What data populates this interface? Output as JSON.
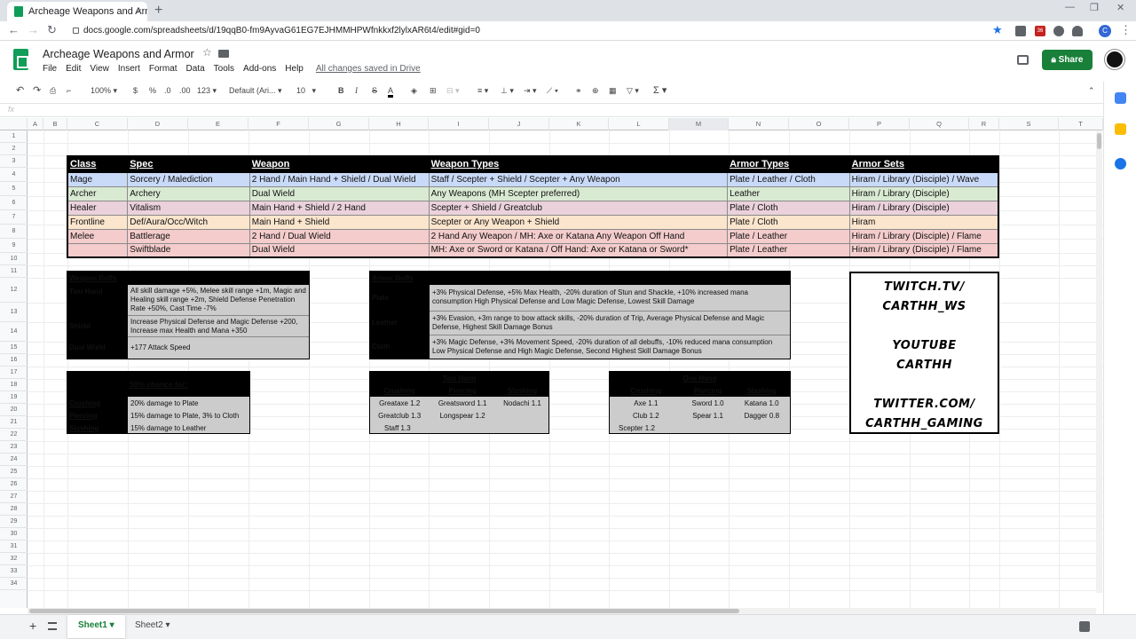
{
  "browser": {
    "tab_title": "Archeage Weapons and Armor -",
    "tab_close": "×",
    "new_tab": "+",
    "url": "docs.google.com/spreadsheets/d/19qqB0-fm9AyvaG61EG7EJHMMHPWfnkkxf2lylxAR6t4/edit#gid=0",
    "ext_badge": "36"
  },
  "doc": {
    "title": "Archeage Weapons and Armor",
    "menus": [
      "File",
      "Edit",
      "View",
      "Insert",
      "Format",
      "Data",
      "Tools",
      "Add-ons",
      "Help"
    ],
    "saved_status": "All changes saved in Drive",
    "share_label": "Share"
  },
  "toolbar": {
    "zoom": "100%",
    "currency": "$",
    "percent": "%",
    "dec_less": ".0",
    "dec_more": ".00",
    "format_more": "123",
    "font": "Default (Ari...",
    "font_size": "10",
    "bold": "B",
    "italic": "I",
    "strike": "S",
    "text_color": "A",
    "functions": "Σ"
  },
  "formula_bar": {
    "fx": "fx"
  },
  "columns": [
    "A",
    "B",
    "C",
    "D",
    "E",
    "F",
    "G",
    "H",
    "I",
    "J",
    "K",
    "L",
    "M",
    "N",
    "O",
    "P",
    "Q",
    "R",
    "S",
    "T"
  ],
  "rows": [
    "1",
    "2",
    "3",
    "4",
    "5",
    "6",
    "7",
    "8",
    "9",
    "10",
    "11",
    "12",
    "13",
    "14",
    "15",
    "16",
    "17",
    "18",
    "19",
    "20",
    "21",
    "22",
    "23",
    "24",
    "25",
    "26",
    "27",
    "28",
    "29",
    "30",
    "31",
    "32",
    "33",
    "34"
  ],
  "main_table": {
    "headers": [
      "Class",
      "Spec",
      "Weapon",
      "Weapon Types",
      "Armor Types",
      "Armor Sets"
    ],
    "rows": [
      {
        "cells": [
          "Mage",
          "Sorcery / Malediction",
          "2 Hand / Main Hand + Shield / Dual Wield",
          "Staff / Scepter + Shield / Scepter + Any Weapon",
          "Plate / Leather / Cloth",
          "Hiram / Library (Disciple) / Wave"
        ],
        "color": "#c9daf8"
      },
      {
        "cells": [
          "Archer",
          "Archery",
          "Dual Wield",
          "Any Weapons (MH Scepter preferred)",
          "Leather",
          "Hiram / Library (Disciple)"
        ],
        "color": "#d9ead3"
      },
      {
        "cells": [
          "Healer",
          "Vitalism",
          "Main Hand + Shield / 2 Hand",
          "Scepter + Shield / Greatclub",
          "Plate / Cloth",
          "Hiram / Library (Disciple)"
        ],
        "color": "#ead1dc"
      },
      {
        "cells": [
          "Frontline",
          "Def/Aura/Occ/Witch",
          "Main Hand + Shield",
          "Scepter or Any Weapon + Shield",
          "Plate / Cloth",
          "Hiram"
        ],
        "color": "#fce5cd"
      },
      {
        "cells": [
          "Melee",
          "Battlerage",
          "2 Hand / Dual Wield",
          "2 Hand Any Weapon / MH: Axe or Katana Any Weapon Off Hand",
          "Plate / Leather",
          "Hiram / Library (Disciple) / Flame"
        ],
        "color": "#f4cccc"
      },
      {
        "cells": [
          "",
          "Swiftblade",
          "Dual Wield",
          "MH: Axe or Sword or Katana / Off Hand: Axe or Katana or Sword*",
          "Plate / Leather",
          "Hiram / Library (Disciple) / Flame"
        ],
        "color": "#f4cccc"
      }
    ]
  },
  "weapon_buffs": {
    "title": "Weapon Buffs",
    "rows": [
      {
        "name": "Two Hand",
        "desc": "All skill damage +5%, Melee skill range +1m, Magic and Healing skill range +2m, Shield Defense Penetration Rate +50%, Cast Time -7%"
      },
      {
        "name": "Shield",
        "desc": "Increase Physical Defense and Magic Defense +200, Increase max Health and Mana +350"
      },
      {
        "name": "Dual Wield",
        "desc": "+177 Attack Speed"
      }
    ]
  },
  "armor_buffs": {
    "title": "Armor Buffs",
    "rows": [
      {
        "name": "Plate",
        "desc": "+3% Physical Defense, +5% Max Health, -20% duration of Stun and Shackle, +10% increased mana consumption High Physical Defense and Low Magic Defense, Lowest Skill Damage"
      },
      {
        "name": "Leather",
        "desc": "+3% Evasion, +3m range to bow attack skills, -20% duration of Trip, Average Physical Defense and Magic Defense, Highest Skill Damage Bonus"
      },
      {
        "name": "Cloth",
        "desc": "+3% Magic Defense, +3% Movement Speed, -20% duration of all debuffs, -10% reduced mana consumption Low Physical Defense and High Magic Defense, Second Highest Skill Damage Bonus"
      }
    ]
  },
  "damage_types": {
    "title": "50% chance for:",
    "rows": [
      {
        "name": "Crushing",
        "desc": "20% damage to Plate"
      },
      {
        "name": "Piercing",
        "desc": "15% damage to Plate, 3% to Cloth"
      },
      {
        "name": "Slashing",
        "desc": "15% damage to Leather"
      }
    ]
  },
  "two_hand": {
    "title": "Two Hand",
    "headers": [
      "Crushing",
      "Piercing",
      "Slashing"
    ],
    "rows": [
      [
        "Greataxe 1.2",
        "Greatsword 1.1",
        "Nodachi 1.1"
      ],
      [
        "Greatclub 1.3",
        "Longspear 1.2",
        ""
      ],
      [
        "Staff 1.3",
        "",
        ""
      ]
    ]
  },
  "one_hand": {
    "title": "One Hand",
    "headers": [
      "Crushing",
      "Piercing",
      "Slashing"
    ],
    "rows": [
      [
        "Axe 1.1",
        "Sword 1.0",
        "Katana 1.0"
      ],
      [
        "Club 1.2",
        "Spear 1.1",
        "Dagger 0.8"
      ],
      [
        "Scepter 1.2",
        "",
        ""
      ]
    ]
  },
  "social": {
    "lines": [
      "TWITCH.TV/",
      "CARTHH_WS",
      "",
      "YOUTUBE",
      "CARTHH",
      "",
      "TWITTER.COM/",
      "CARTHH_GAMING"
    ]
  },
  "sheet_tabs": {
    "sheet1": "Sheet1",
    "sheet2": "Sheet2",
    "add": "+"
  }
}
